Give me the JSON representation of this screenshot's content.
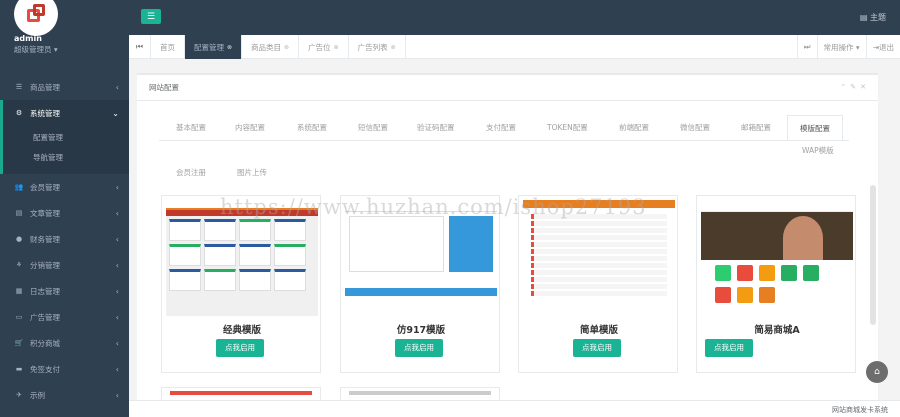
{
  "sidebar": {
    "admin_name": "admin",
    "admin_role": "超级管理员 ▾",
    "items": [
      {
        "label": "商品管理",
        "icon": "list-icon"
      },
      {
        "label": "系统管理",
        "icon": "gear-icon"
      },
      {
        "label": "会员管理",
        "icon": "users-icon"
      },
      {
        "label": "文章管理",
        "icon": "file-icon"
      },
      {
        "label": "财务管理",
        "icon": "money-icon"
      },
      {
        "label": "分销管理",
        "icon": "share-icon"
      },
      {
        "label": "日志管理",
        "icon": "calendar-icon"
      },
      {
        "label": "广告管理",
        "icon": "image-icon"
      },
      {
        "label": "积分商城",
        "icon": "cart-icon"
      },
      {
        "label": "免签支付",
        "icon": "card-icon"
      },
      {
        "label": "示例",
        "icon": "plane-icon"
      }
    ],
    "submenu": [
      "配置管理",
      "导航管理"
    ]
  },
  "topbar": {
    "theme_label": "主题"
  },
  "tabbar": {
    "tabs": [
      {
        "label": "首页"
      },
      {
        "label": "配置管理"
      },
      {
        "label": "商品类目"
      },
      {
        "label": "广告位"
      },
      {
        "label": "广告列表"
      }
    ],
    "ops_label": "常用操作 ▾",
    "logout_label": "退出"
  },
  "panel": {
    "title": "网站配置",
    "subtabs": [
      "基本配置",
      "内容配置",
      "系统配置",
      "短信配置",
      "验证码配置",
      "支付配置",
      "TOKEN配置",
      "前端配置",
      "微信配置",
      "邮箱配置",
      "模版配置",
      "WAP模版",
      "会员注册",
      "图片上传"
    ],
    "templates": [
      {
        "name": "经典模版",
        "button": "点我启用"
      },
      {
        "name": "仿917模版",
        "button": "点我启用"
      },
      {
        "name": "简单模版",
        "button": "点我启用"
      },
      {
        "name": "简易商城A",
        "button": "点我启用"
      }
    ]
  },
  "watermark": "https://www.huzhan.com/ishop27193",
  "footer": "网站商城发卡系统"
}
